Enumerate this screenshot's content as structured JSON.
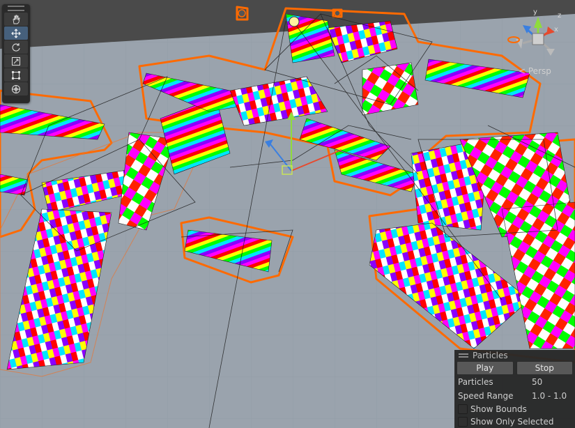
{
  "scene_view": {
    "persp_label": "Persp",
    "gizmo_axes": {
      "x": "x",
      "y": "y",
      "z": "z"
    }
  },
  "toolbar": {
    "tools": [
      {
        "name": "hand",
        "icon": "hand-icon",
        "active": false
      },
      {
        "name": "move",
        "icon": "move-icon",
        "active": true
      },
      {
        "name": "rotate",
        "icon": "rotate-icon",
        "active": false
      },
      {
        "name": "scale",
        "icon": "scale-icon",
        "active": false
      },
      {
        "name": "rect",
        "icon": "rect-transform-icon",
        "active": false
      },
      {
        "name": "transform",
        "icon": "transform-icon",
        "active": false
      }
    ]
  },
  "particles_panel": {
    "title": "Particles",
    "play_label": "Play",
    "stop_label": "Stop",
    "particles_label": "Particles",
    "particles_value": "50",
    "speed_label": "Speed Range",
    "speed_value": "1.0 - 1.0",
    "show_bounds_label": "Show Bounds",
    "show_only_selected_label": "Show Only Selected"
  },
  "colors": {
    "selection_outline": "#ff6a00",
    "ground": "#9aa3ad",
    "tile_palette": [
      "#ff00ff",
      "#ff0000",
      "#ffff00",
      "#00ff00",
      "#00e5ff",
      "#8a00ff",
      "#ffffff",
      "#f2f2f2"
    ]
  }
}
